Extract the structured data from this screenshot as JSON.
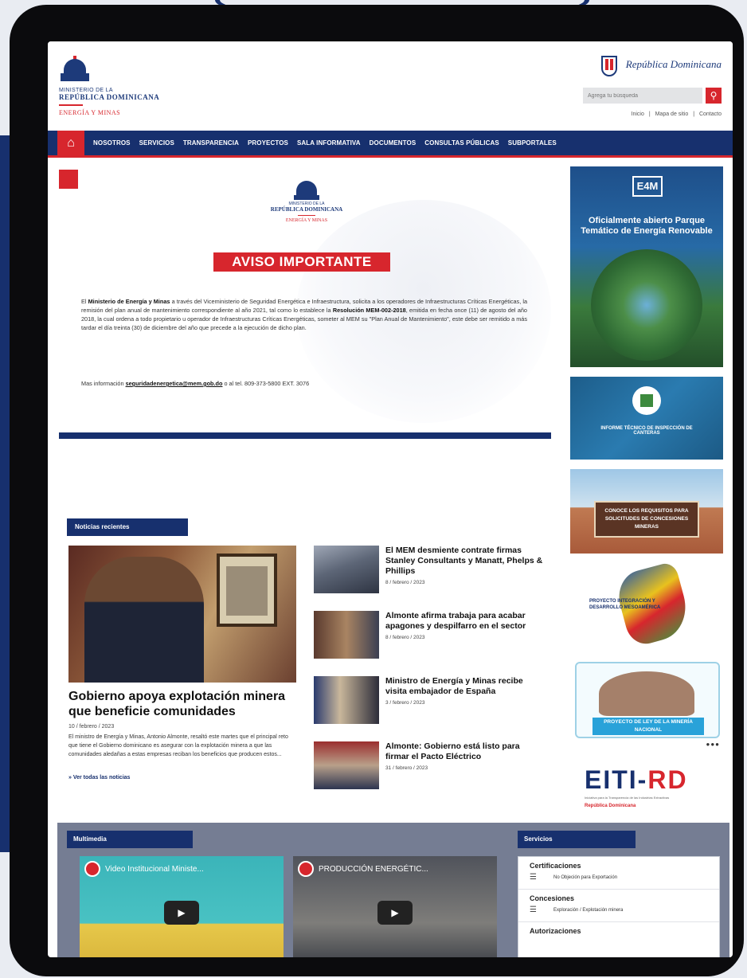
{
  "header": {
    "logo_line1": "MINISTERIO DE LA",
    "logo_line2": "REPÚBLICA DOMINICANA",
    "logo_line3": "ENERGÍA Y MINAS",
    "brand_text": "República Dominicana",
    "search_placeholder": "Agrega tu búsqueda",
    "search_icon": "search-icon",
    "util_links": [
      "Inicio",
      "|",
      "Mapa de sitio",
      "|",
      "Contacto"
    ]
  },
  "nav": {
    "home_icon": "home-icon",
    "items": [
      "NOSOTROS",
      "SERVICIOS",
      "TRANSPARENCIA",
      "PROYECTOS",
      "SALA INFORMATIVA",
      "DOCUMENTOS",
      "CONSULTAS PÚBLICAS",
      "SUBPORTALES"
    ]
  },
  "notice": {
    "logo_line1": "MINISTERIO DE LA",
    "logo_line2": "REPÚBLICA DOMINICANA",
    "logo_line3": "ENERGÍA Y MINAS",
    "heading": "AVISO IMPORTANTE",
    "body_bold1": "Ministerio de Energía y Minas",
    "body_p1": "El ",
    "body_p2": " a través del Viceministerio de Seguridad Energética e Infraestructura, solicita a los operadores de Infraestructuras Críticas Energéticas, la remisión del plan anual de mantenimiento correspondiente al año 2021, tal como lo establece la ",
    "body_bold2": "Resolución MEM-002-2018",
    "body_p3": ", emitida en fecha once (11) de agosto del año 2018, la cual ordena a todo propietario u operador de Infraestructuras Críticas Energéticas, someter al MEM su \"Plan Anual de Mantenimiento\", este debe ser remitido a más tardar el día treinta (30) de diciembre del año que precede a la ejecución de dicho plan.",
    "contact_prefix": "Mas información ",
    "contact_email": "seguridadenergetica@mem.gob.do",
    "contact_suffix": " o al tel. 809-373-5800 EXT. 3076"
  },
  "news": {
    "section_title": "Noticias recientes",
    "featured": {
      "title": "Gobierno apoya explotación minera que beneficie comunidades",
      "date": "10 / febrero / 2023",
      "excerpt": "El ministro de Energía y Minas, Antonio Almonte, resaltó este martes que el principal reto que tiene el Gobierno dominicano es asegurar con la explotación minera a que las comunidades aledañas a estas empresas reciban los beneficios que producen estos..."
    },
    "items": [
      {
        "title": "El MEM desmiente contrate firmas Stanley Consultants y Manatt, Phelps & Phillips",
        "date": "8 / febrero / 2023"
      },
      {
        "title": "Almonte afirma trabaja para acabar apagones y despilfarro en el sector",
        "date": "8 / febrero / 2023"
      },
      {
        "title": "Ministro de Energía y Minas recibe visita embajador de España",
        "date": "3 / febrero / 2023"
      },
      {
        "title": "Almonte: Gobierno está listo para firmar el Pacto Eléctrico",
        "date": "31 / febrero / 2023"
      }
    ],
    "all_news": "» Ver todas las noticias"
  },
  "sidebar": {
    "banner1_logo": "E4M",
    "banner1_text": "Oficialmente abierto Parque Temático de Energía Renovable",
    "banner2_text": "INFORME TÉCNICO DE INSPECCIÓN DE CANTERAS",
    "banner3_text": "CONOCE LOS REQUISITOS PARA SOLICITUDES DE CONCESIONES MINERAS",
    "banner4_text": "PROYECTO INTEGRACIÓN Y DESARROLLO MESOAMÉRICA",
    "banner5_text": "PROYECTO DE LEY DE LA MINERÍA NACIONAL",
    "eiti_blue": "EITI-",
    "eiti_red": "RD",
    "eiti_sub": "Iniciativa para la Transparencia de las Industrias Extractivas",
    "eiti_rd": "República Dominicana"
  },
  "bottom": {
    "multimedia_title": "Multimedia",
    "video1_title": "Video Institucional Ministe...",
    "video2_title": "PRODUCCIÓN ENERGÉTIC...",
    "services_title": "Servicios",
    "services": [
      {
        "heading": "Certificaciones",
        "item": "No Objeción para Exportación"
      },
      {
        "heading": "Concesiones",
        "item": "Exploración / Explotación minera"
      },
      {
        "heading": "Autorizaciones",
        "item": ""
      }
    ]
  },
  "colors": {
    "navy": "#17306e",
    "red": "#d7262d"
  }
}
